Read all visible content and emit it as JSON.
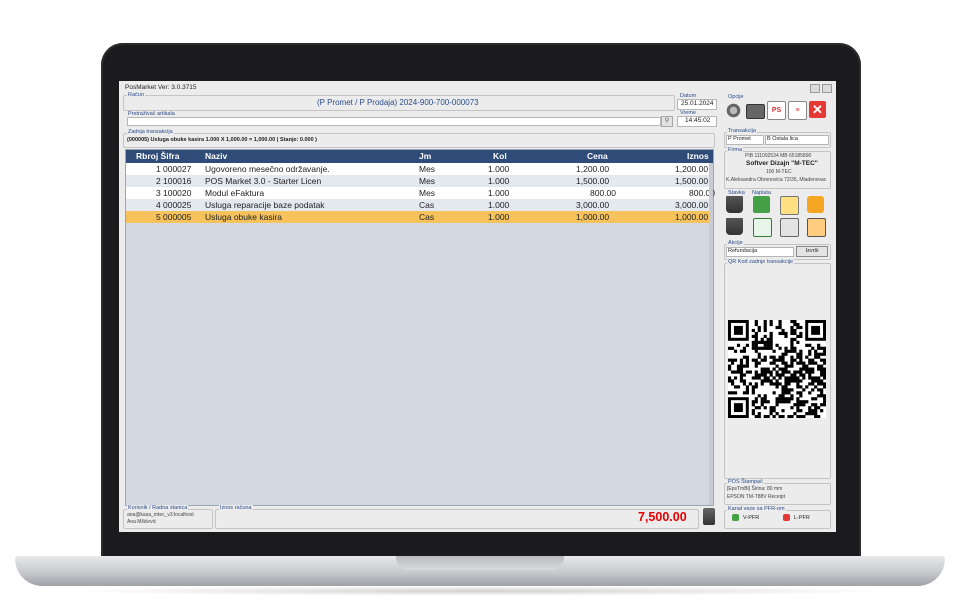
{
  "app": {
    "title": "PosMarket Ver: 3.0.3715"
  },
  "racun": {
    "label": "Račun",
    "value": "(P Promet / P Prodaja) 2024-900-700-000073"
  },
  "datum": {
    "label": "Datum",
    "value": "25.01.2024"
  },
  "vreme": {
    "label": "Vreme",
    "value": "14:45:02"
  },
  "search": {
    "label": "Pretraživač artikala",
    "value": ""
  },
  "last_tx": {
    "label": "Zadnja transakcija",
    "value": "(000005) Usluga obuke kasira 1.000 X 1,000.00 = 1,000.00 ( Stanje: 0.000 )"
  },
  "table": {
    "headers": [
      "Rbroj Šifra",
      "Naziv",
      "Jm",
      "Kol",
      "Cena",
      "Iznos"
    ],
    "rows": [
      {
        "rb": "1",
        "sifra": "000027",
        "naziv": "Ugovoreno mesečno održavanje.",
        "jm": "Mes",
        "kol": "1.000",
        "cena": "1,200.00",
        "iznos": "1,200.00"
      },
      {
        "rb": "2",
        "sifra": "100016",
        "naziv": "POS Market 3.0 - Starter Licen",
        "jm": "Mes",
        "kol": "1.000",
        "cena": "1,500.00",
        "iznos": "1,500.00"
      },
      {
        "rb": "3",
        "sifra": "100020",
        "naziv": "Modul eFaktura",
        "jm": "Mes",
        "kol": "1.000",
        "cena": "800.00",
        "iznos": "800.00"
      },
      {
        "rb": "4",
        "sifra": "000025",
        "naziv": "Usluga reparacije baze podatak",
        "jm": "Cas",
        "kol": "1.000",
        "cena": "3,000.00",
        "iznos": "3,000.00"
      },
      {
        "rb": "5",
        "sifra": "000005",
        "naziv": "Usluga obuke kasira",
        "jm": "Cas",
        "kol": "1.000",
        "cena": "1,000.00",
        "iznos": "1,000.00"
      }
    ]
  },
  "korisnik": {
    "label": "Korisnik / Radna stanica",
    "line1": "ana@kasa_mtec_v3:localhost",
    "line2": "Ana Milićević"
  },
  "iznos": {
    "label": "Iznos računa",
    "value": "7,500.00"
  },
  "opcije": {
    "label": "Opcije"
  },
  "transakcija": {
    "label": "Transakcija",
    "tip": "P Promet",
    "kupac": "B Ostala lica"
  },
  "firma": {
    "label": "Firma",
    "pib": "PIB 111092534 MB 65185890",
    "naziv": "Softver Dizajn \"M-TEC\"",
    "mesto": "100 M-TEC",
    "adresa": "K.Aleksandra Obrenovića 72/35, Mladenovac"
  },
  "stavka": {
    "label": "Stavka"
  },
  "naplata": {
    "label": "Naplata"
  },
  "akcije": {
    "label": "Akcije",
    "value": "Refundacija",
    "button": "Izvrši"
  },
  "qr": {
    "label": "QR Kod zadnje transakcije"
  },
  "pos_stampac": {
    "label": "POS Štampač",
    "line1": "[EpsTmBl] Širina: 80 mm",
    "line2": "EPSON TM-T88V Receipt"
  },
  "kanal": {
    "label": "Kanal veze sa PFR-om",
    "vpfr": "V-PFR",
    "lpfr": "L-PFR"
  },
  "colors": {
    "header": "#2f4c78",
    "selected_row": "#f5c25c",
    "total": "#e60000",
    "close": "#e53935"
  }
}
